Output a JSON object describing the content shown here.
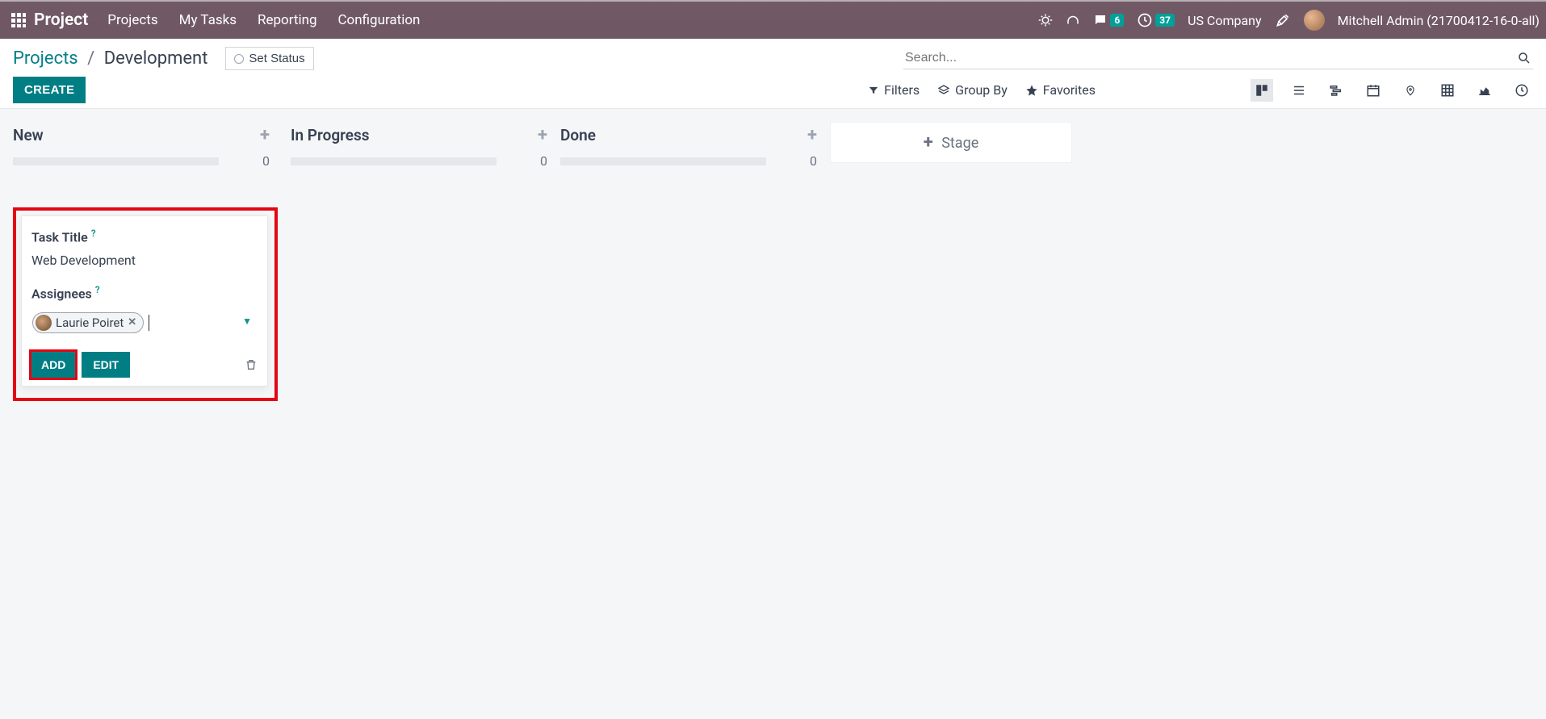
{
  "topbar": {
    "brand": "Project",
    "nav": [
      "Projects",
      "My Tasks",
      "Reporting",
      "Configuration"
    ],
    "messages_count": "6",
    "activities_count": "37",
    "company": "US Company",
    "user": "Mitchell Admin (21700412-16-0-all)"
  },
  "breadcrumb": {
    "root": "Projects",
    "current": "Development"
  },
  "controls": {
    "set_status": "Set Status",
    "create": "CREATE",
    "search_placeholder": "Search...",
    "filters": "Filters",
    "group_by": "Group By",
    "favorites": "Favorites"
  },
  "kanban": {
    "columns": [
      {
        "title": "New",
        "count": "0"
      },
      {
        "title": "In Progress",
        "count": "0"
      },
      {
        "title": "Done",
        "count": "0"
      }
    ],
    "add_stage": "Stage"
  },
  "quick": {
    "title_label": "Task Title",
    "title_value": "Web Development",
    "assignees_label": "Assignees",
    "assignee_name": "Laurie Poiret",
    "add": "ADD",
    "edit": "EDIT"
  }
}
